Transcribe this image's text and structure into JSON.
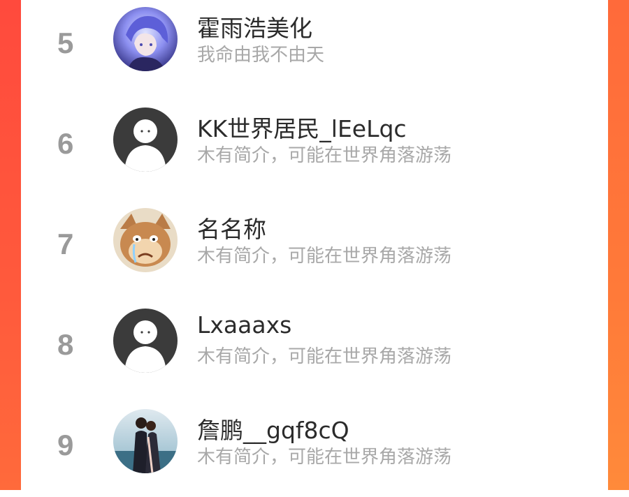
{
  "colors": {
    "accent_left": "#ff4a3d",
    "accent_right": "#ff8a3a",
    "rank": "#9a9a9a",
    "name": "#2b2b2b",
    "bio": "#a8a8a8"
  },
  "list": [
    {
      "rank": "5",
      "name": "霍雨浩美化",
      "bio": "我命由我不由天",
      "avatar": "anime-avatar"
    },
    {
      "rank": "6",
      "name": "KK世界居民_lEeLqc",
      "bio": "木有简介，可能在世界角落游荡",
      "avatar": "default-avatar"
    },
    {
      "rank": "7",
      "name": "名名称",
      "bio": "木有简介，可能在世界角落游荡",
      "avatar": "cat-avatar"
    },
    {
      "rank": "8",
      "name": "Lxaaaxs",
      "bio": "木有简介，可能在世界角落游荡",
      "avatar": "default-avatar"
    },
    {
      "rank": "9",
      "name": "詹鹏__gqf8cQ",
      "bio": "木有简介，可能在世界角落游荡",
      "avatar": "couple-photo-avatar"
    }
  ]
}
